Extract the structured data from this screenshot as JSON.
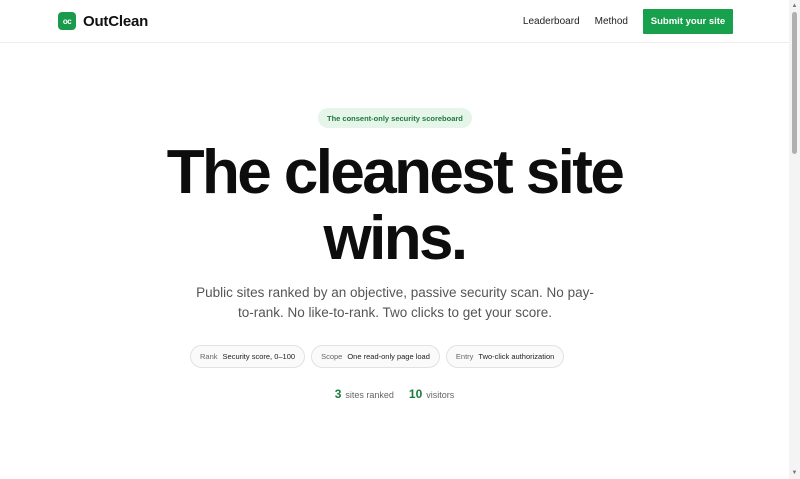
{
  "header": {
    "brand_logo": "oc",
    "brand_name": "OutClean",
    "nav": [
      {
        "label": "Leaderboard"
      },
      {
        "label": "Method"
      }
    ],
    "cta_label": "Submit your site"
  },
  "hero": {
    "pill": "The consent-only security scoreboard",
    "title_line1": "The cleanest site",
    "title_line2": "wins.",
    "subtitle": "Public sites ranked by an objective, passive security scan. No pay-to-rank. No like-to-rank. Two clicks to get your score.",
    "chips": [
      {
        "key": "Rank",
        "value": "Security score, 0–100"
      },
      {
        "key": "Scope",
        "value": "One read-only page load"
      },
      {
        "key": "Entry",
        "value": "Two-click authorization"
      }
    ],
    "stats": [
      {
        "value": "3",
        "label": "sites ranked"
      },
      {
        "value": "10",
        "label": "visitors"
      }
    ]
  },
  "colors": {
    "accent": "#17a14c",
    "pill_bg": "#e6f5ea",
    "pill_text": "#1d7a3c"
  },
  "icons": {
    "scroll_up": "▲",
    "scroll_down": "▼"
  }
}
